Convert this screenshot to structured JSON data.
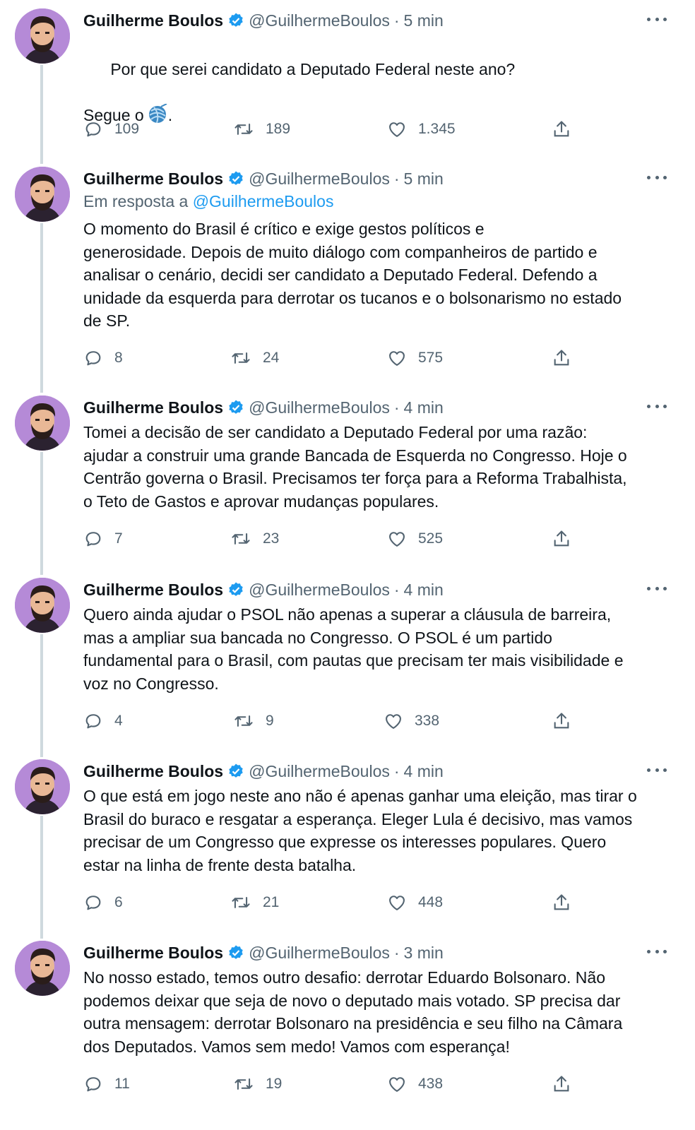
{
  "author": {
    "name": "Guilherme Boulos",
    "handle": "@GuilhermeBoulos"
  },
  "colors": {
    "text": "#0f1419",
    "secondary": "#536471",
    "link": "#1d9bf0",
    "verified": "#1d9bf0",
    "thread_line": "#cfd9de",
    "avatar_bg": "#b58ad7"
  },
  "icons": {
    "reply": "speech-bubble-icon",
    "retweet": "retweet-arrows-icon",
    "like": "heart-icon",
    "share": "share-upload-icon",
    "more": "more-dots-icon",
    "verified": "verified-badge-icon",
    "yarn": "yarn-ball-emoji"
  },
  "tweets": [
    {
      "time": "5 min",
      "reply_prefix": "",
      "reply_mention": "",
      "text": "Por que serei candidato a Deputado Federal neste ano?\n\nSegue o",
      "text_after_emoji": ".",
      "replies": "109",
      "retweets": "189",
      "likes": "1.345"
    },
    {
      "time": "5 min",
      "reply_prefix": "Em resposta a",
      "reply_mention": "@GuilhermeBoulos",
      "text": "O momento do Brasil é crítico e exige gestos políticos e\ngenerosidade. Depois de muito diálogo com companheiros de partido e\nanalisar o cenário, decidi ser candidato a Deputado Federal. Defendo a\nunidade da esquerda para derrotar os tucanos e o bolsonarismo no estado\nde SP.",
      "replies": "8",
      "retweets": "24",
      "likes": "575"
    },
    {
      "time": "4 min",
      "text": "Tomei a decisão de ser candidato a Deputado Federal por uma razão:\najudar a construir uma grande Bancada de Esquerda no Congresso. Hoje o\nCentrão governa o Brasil. Precisamos ter força para a Reforma Trabalhista,\no Teto de Gastos e aprovar mudanças populares.",
      "replies": "7",
      "retweets": "23",
      "likes": "525"
    },
    {
      "time": "4 min",
      "text": "Quero ainda ajudar o PSOL não apenas a superar a cláusula de barreira,\nmas a ampliar sua bancada no Congresso. O PSOL é um partido\nfundamental para o Brasil, com pautas que precisam ter mais visibilidade e\nvoz no Congresso.",
      "replies": "4",
      "retweets": "9",
      "likes": "338"
    },
    {
      "time": "4 min",
      "text": "O que está em jogo neste ano não é apenas ganhar uma eleição, mas tirar o\nBrasil do buraco e resgatar a esperança. Eleger Lula é decisivo, mas vamos\nprecisar de um Congresso que expresse os interesses populares. Quero\nestar na linha de frente desta batalha.",
      "replies": "6",
      "retweets": "21",
      "likes": "448"
    },
    {
      "time": "3 min",
      "text": "No nosso estado, temos outro desafio: derrotar Eduardo Bolsonaro. Não\npodemos deixar que seja de novo o deputado mais votado. SP precisa dar\noutra mensagem: derrotar Bolsonaro na presidência e seu filho na Câmara\ndos Deputados. Vamos sem medo! Vamos com esperança!",
      "replies": "11",
      "retweets": "19",
      "likes": "438"
    }
  ]
}
